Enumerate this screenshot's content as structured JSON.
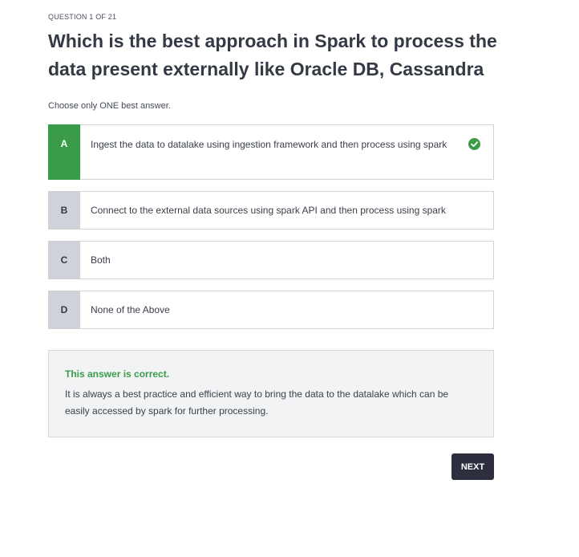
{
  "question": {
    "counter": "QUESTION 1 OF 21",
    "title": "Which is the best approach in Spark to process the data present externally like Oracle DB, Cassandra",
    "instruction": "Choose only ONE best answer."
  },
  "options": [
    {
      "letter": "A",
      "text": "Ingest the data to datalake using ingestion framework and then process using spark",
      "selected": true
    },
    {
      "letter": "B",
      "text": "Connect to the external data sources using spark API and then process using spark",
      "selected": false
    },
    {
      "letter": "C",
      "text": "Both",
      "selected": false
    },
    {
      "letter": "D",
      "text": "None of the Above",
      "selected": false
    }
  ],
  "feedback": {
    "title": "This answer is correct.",
    "text": "It is always a best practice and efficient way to bring the data to the datalake which can be easily accessed by spark for further processing."
  },
  "actions": {
    "next_label": "NEXT"
  },
  "colors": {
    "correct": "#3a9b48",
    "letter_bg": "#cfd2d9",
    "button_bg": "#2d2f3f"
  },
  "icons": {
    "selected_check": "check-circle-icon"
  }
}
